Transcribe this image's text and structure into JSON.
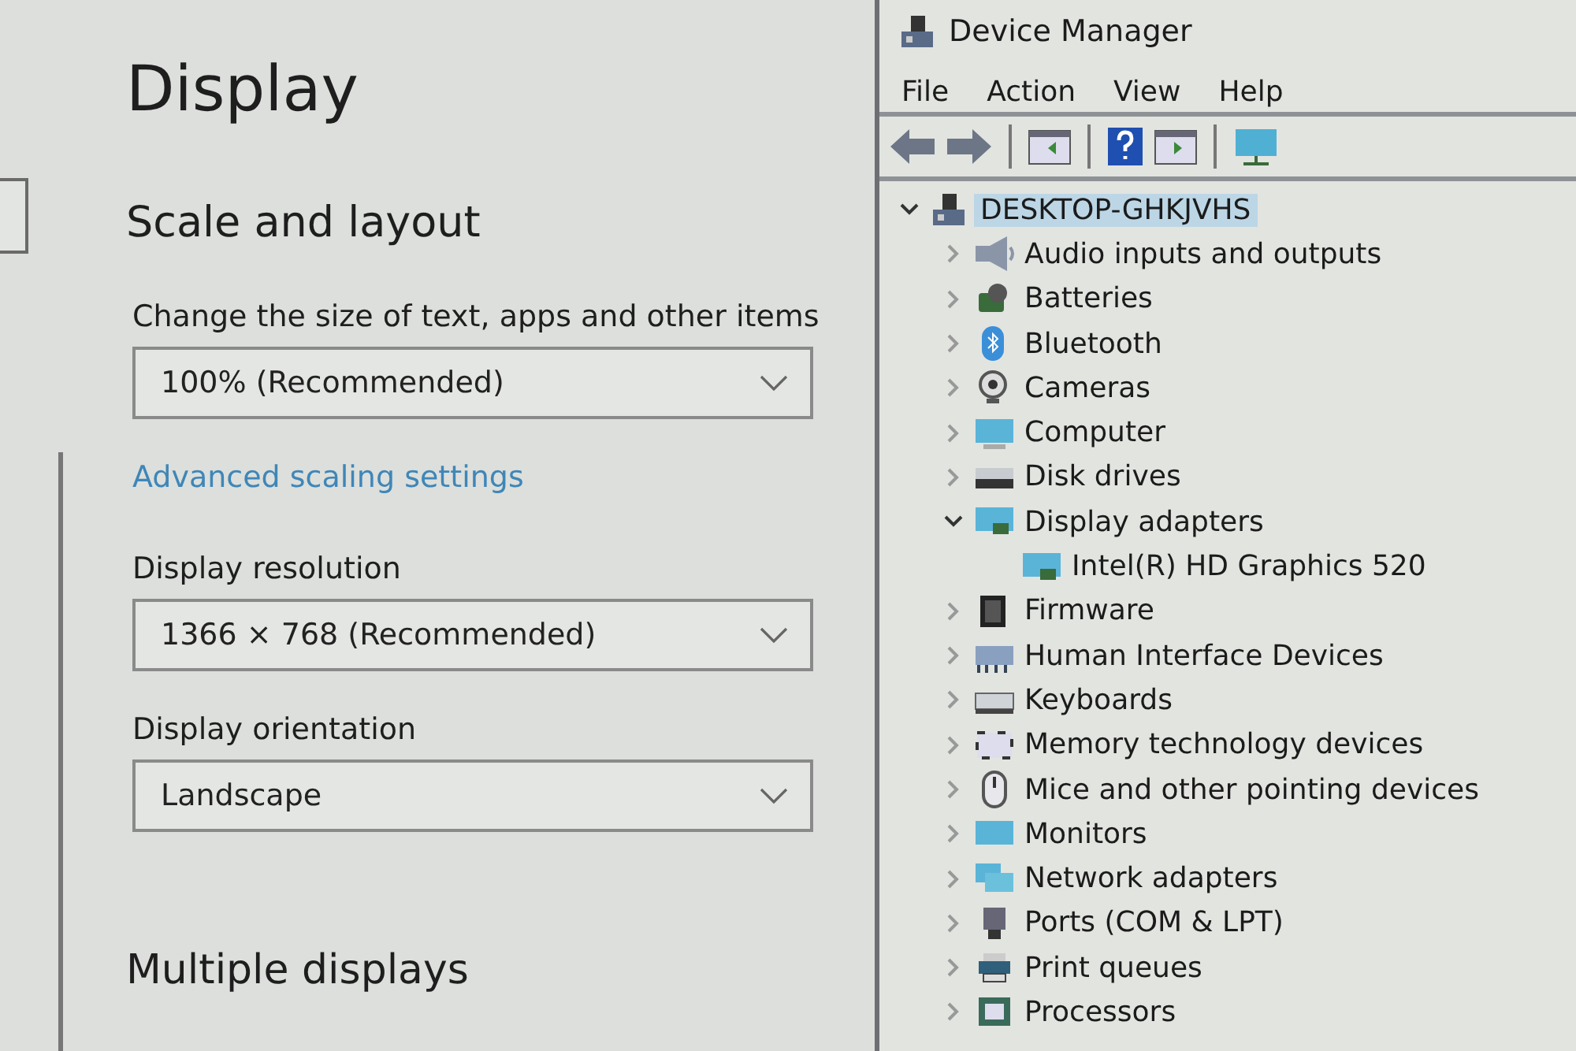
{
  "settings": {
    "title": "Display",
    "section": "Scale and layout",
    "scale": {
      "label": "Change the size of text, apps and other items",
      "value": "100% (Recommended)"
    },
    "link": "Advanced scaling settings",
    "resolution": {
      "label": "Display resolution",
      "value": "1366 × 768 (Recommended)"
    },
    "orientation": {
      "label": "Display orientation",
      "value": "Landscape"
    },
    "next_section": "Multiple displays"
  },
  "device_manager": {
    "title": "Device Manager",
    "menu": [
      "File",
      "Action",
      "View",
      "Help"
    ],
    "tree": {
      "label": "DESKTOP-GHKJVHS",
      "expanded": true,
      "selected": true,
      "children": [
        {
          "label": "Audio inputs and outputs",
          "expanded": false
        },
        {
          "label": "Batteries",
          "expanded": false
        },
        {
          "label": "Bluetooth",
          "expanded": false
        },
        {
          "label": "Cameras",
          "expanded": false
        },
        {
          "label": "Computer",
          "expanded": false
        },
        {
          "label": "Disk drives",
          "expanded": false
        },
        {
          "label": "Display adapters",
          "expanded": true,
          "children": [
            {
              "label": "Intel(R) HD Graphics 520"
            }
          ]
        },
        {
          "label": "Firmware",
          "expanded": false
        },
        {
          "label": "Human Interface Devices",
          "expanded": false
        },
        {
          "label": "Keyboards",
          "expanded": false
        },
        {
          "label": "Memory technology devices",
          "expanded": false
        },
        {
          "label": "Mice and other pointing devices",
          "expanded": false
        },
        {
          "label": "Monitors",
          "expanded": false
        },
        {
          "label": "Network adapters",
          "expanded": false
        },
        {
          "label": "Ports (COM & LPT)",
          "expanded": false
        },
        {
          "label": "Print queues",
          "expanded": false
        },
        {
          "label": "Processors",
          "expanded": false
        }
      ]
    }
  }
}
